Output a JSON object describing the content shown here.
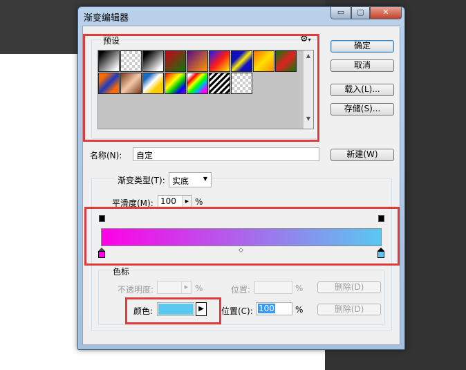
{
  "window": {
    "title": "渐变编辑器",
    "min_label": "▭",
    "max_label": "▢",
    "close_label": "✕"
  },
  "presets": {
    "label": "预设",
    "menu_icon": "gear-icon"
  },
  "buttons": {
    "ok": "确定",
    "cancel": "取消",
    "load": "载入(L)...",
    "save": "存储(S)...",
    "new": "新建(W)"
  },
  "name": {
    "label": "名称(N):",
    "value": "自定"
  },
  "gradient_type": {
    "label": "渐变类型(T):",
    "value": "实底"
  },
  "smoothness": {
    "label": "平滑度(M):",
    "value": "100",
    "unit": "%"
  },
  "gradient": {
    "start_color": "#ff00e6",
    "end_color": "#5ac8f0"
  },
  "color_stops": {
    "label": "色标",
    "opacity_label": "不透明度:",
    "opacity_value": "",
    "opacity_unit": "%",
    "position1_label": "位置:",
    "position1_value": "",
    "position1_unit": "%",
    "delete1": "删除(D)",
    "color_label": "颜色:",
    "color_value": "#5ac8f0",
    "position2_label": "位置(C):",
    "position2_value": "100",
    "position2_unit": "%",
    "delete2": "删除(D)"
  }
}
